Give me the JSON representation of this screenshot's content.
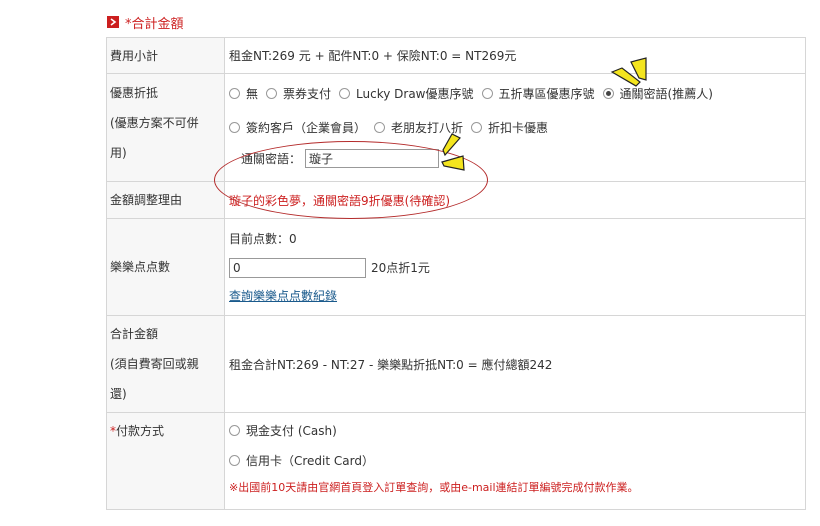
{
  "section": {
    "title": "*合計金額"
  },
  "rows": {
    "subtotal": {
      "label": "費用小計",
      "value": "租金NT:269 元 + 配件NT:0 + 保險NT:0 = NT269元"
    },
    "discount": {
      "label_line1": "優惠折抵",
      "label_line2": "(優惠方案不可併",
      "label_line3": "用)",
      "options_row1": [
        "無",
        "票券支付",
        "Lucky Draw優惠序號",
        "五折專區優惠序號",
        "通關密語(推薦人)"
      ],
      "options_row2": [
        "簽約客戶（企業會員）",
        "老朋友打八折",
        "折扣卡優惠"
      ],
      "passcode_label": "通關密語：",
      "passcode_value": "璇子"
    },
    "adjust": {
      "label": "金額調整理由",
      "value": "璇子的彩色夢，通關密語9折優惠(待確認)"
    },
    "points": {
      "label": "樂樂点点數",
      "current": "目前点數：0",
      "input_value": "0",
      "rate": "20点折1元",
      "link": "查詢樂樂点点數紀錄"
    },
    "total": {
      "label_line1": "合計金額",
      "label_line2": "(須自費寄回或親",
      "label_line3": "還)",
      "value": "租金合計NT:269 - NT:27 - 樂樂點折抵NT:0 = 應付總額242"
    },
    "payment": {
      "label_req": "*",
      "label": "付款方式",
      "option1": "現金支付 (Cash)",
      "option2": "信用卡（Credit Card）",
      "note": "※出國前10天請由官網首頁登入訂單查詢，或由e-mail連結訂單編號完成付款作業。"
    }
  },
  "colors": {
    "accent_red": "#cc1f1f",
    "annotation_yellow": "#f4e51e",
    "link_blue": "#1a5a8c"
  }
}
